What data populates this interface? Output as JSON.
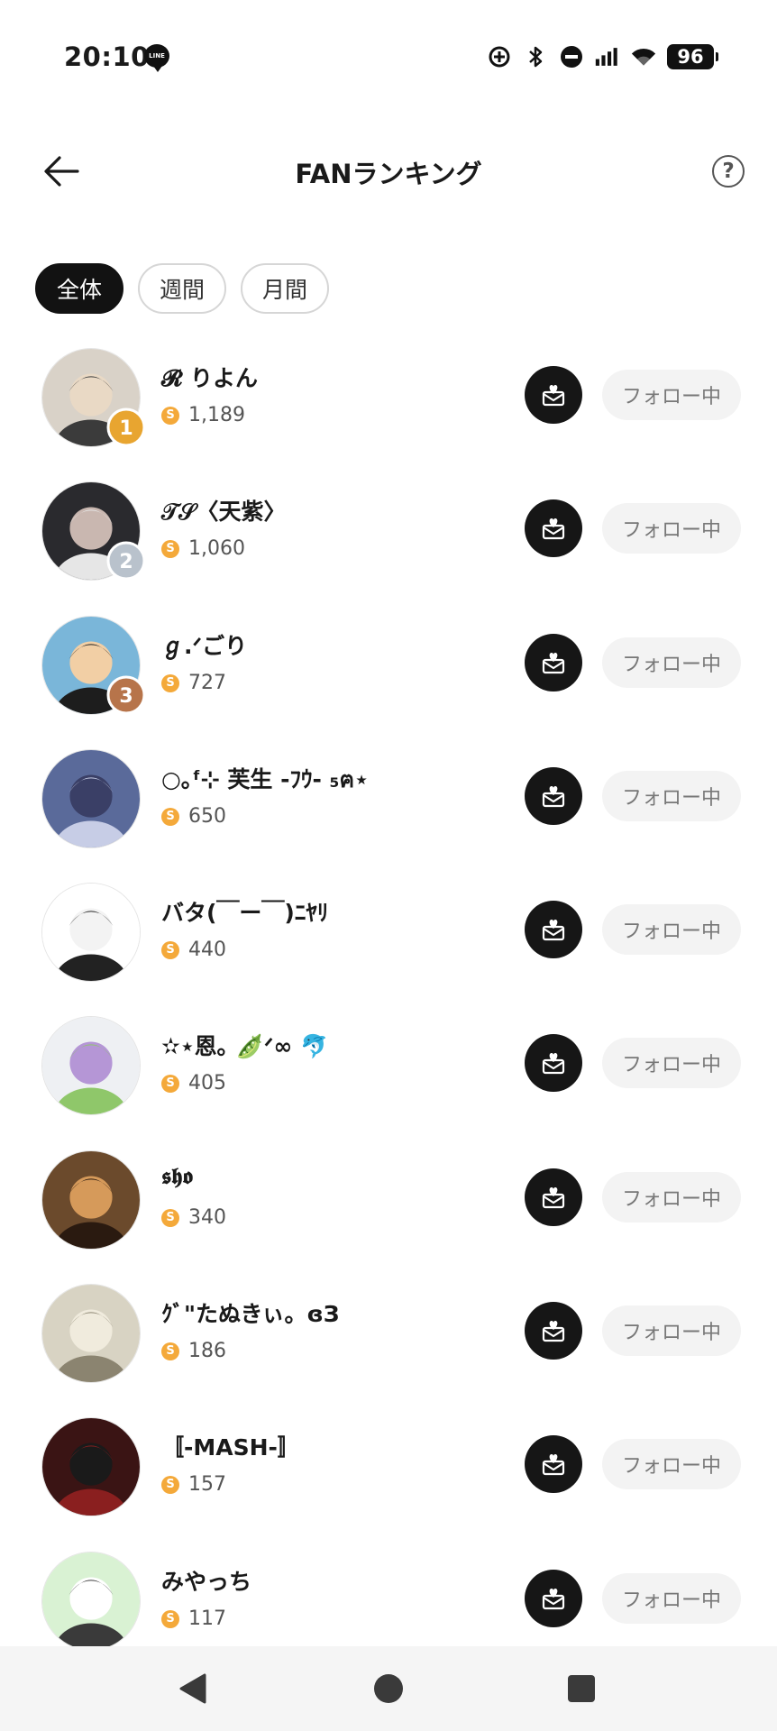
{
  "status_bar": {
    "time": "20:10",
    "line_label": "LINE",
    "battery": "96",
    "icons": [
      "location-icon",
      "bluetooth-icon",
      "dnd-icon",
      "signal-icon",
      "wifi-icon",
      "battery-icon"
    ]
  },
  "header": {
    "title": "FANランキング",
    "help_label": "?"
  },
  "filters": [
    {
      "label": "全体",
      "active": true
    },
    {
      "label": "週間",
      "active": false
    },
    {
      "label": "月間",
      "active": false
    }
  ],
  "ranking": [
    {
      "name": "𝓡 りよん",
      "coins": "1,189",
      "follow_label": "フォロー中",
      "badge": "1"
    },
    {
      "name": "𝒯𝒮〈天紫〉",
      "coins": "1,060",
      "follow_label": "フォロー中",
      "badge": "2"
    },
    {
      "name": "ℊ.ᐟごり",
      "coins": "727",
      "follow_label": "フォロー中",
      "badge": "3"
    },
    {
      "name": "○｡ᶠ⊹ 芙生 -ﾌｳ- ₅ฅ⋆",
      "coins": "650",
      "follow_label": "フォロー中",
      "badge": ""
    },
    {
      "name": "バタ(￣ー￣)ﾆﾔﾘ",
      "coins": "440",
      "follow_label": "フォロー中",
      "badge": ""
    },
    {
      "name": "✫⋆恩｡ 🫛ᐟ∞ 🐬",
      "coins": "405",
      "follow_label": "フォロー中",
      "badge": ""
    },
    {
      "name": "𝖘𝖍𝖔",
      "coins": "340",
      "follow_label": "フォロー中",
      "badge": ""
    },
    {
      "name": "ｸﾞ\"たぬきぃ。ɞЗ",
      "coins": "186",
      "follow_label": "フォロー中",
      "badge": ""
    },
    {
      "name": "〚-MASH-〛",
      "coins": "157",
      "follow_label": "フォロー中",
      "badge": ""
    },
    {
      "name": "みやっち",
      "coins": "117",
      "follow_label": "フォロー中",
      "badge": ""
    }
  ],
  "coin_symbol": "S",
  "colors": {
    "chip_active": "#121212",
    "coin": "#f4a93a",
    "follow_bg": "#f3f3f3",
    "gift_bg": "#161616"
  },
  "nav_bar": {
    "icons": [
      "back-triangle-icon",
      "home-circle-icon",
      "recents-square-icon"
    ]
  }
}
